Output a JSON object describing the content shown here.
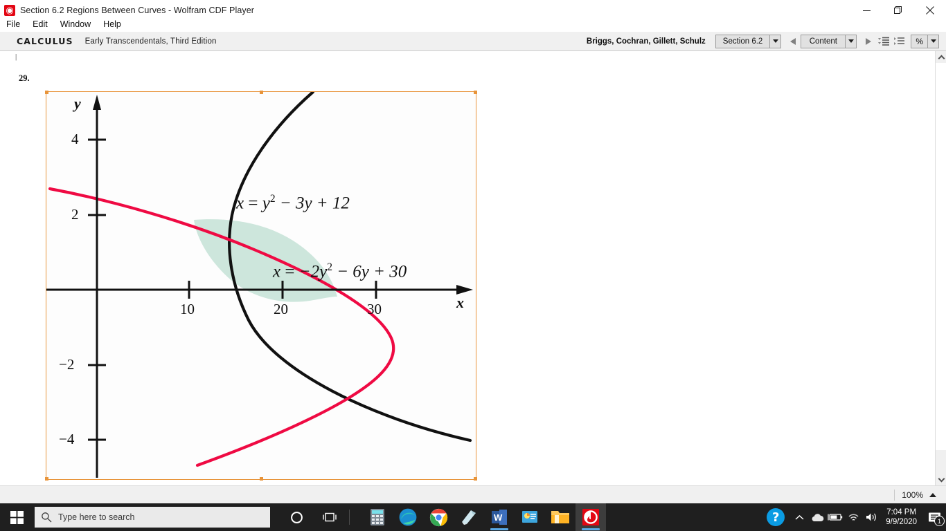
{
  "window": {
    "title": "Section 6.2 Regions Between Curves - Wolfram CDF Player",
    "app_icon": "wolfram-spikey-icon",
    "minimize_label": "Minimize",
    "maximize_label": "Restore",
    "close_label": "Close"
  },
  "menubar": {
    "items": [
      {
        "label": "File"
      },
      {
        "label": "Edit"
      },
      {
        "label": "Window"
      },
      {
        "label": "Help"
      }
    ]
  },
  "toolbar": {
    "brand": "CALCULUS",
    "subtitle": "Early Transcendentals, Third Edition",
    "authors": "Briggs, Cochran, Gillett, Schulz",
    "section_selector": "Section 6.2",
    "content_selector": "Content",
    "prev_label": "Previous",
    "next_label": "Next",
    "percent_selector": "%",
    "list_icon_1": "collapse-all-icon",
    "list_icon_2": "expand-all-icon"
  },
  "document": {
    "tick_above": "|",
    "problem_number": "29.",
    "figure": {
      "x_axis_name": "x",
      "y_axis_name": "y",
      "x_ticks": [
        "10",
        "20",
        "30"
      ],
      "y_ticks": [
        "4",
        "2",
        "−2",
        "−4"
      ],
      "equation_1": {
        "lhs": "x",
        "eq": "=",
        "term1": "y",
        "exp1": "2",
        "rest": "− 3y + 12",
        "color": "#111111"
      },
      "equation_2": {
        "lhs": "x",
        "eq": "=",
        "term1": "−2y",
        "exp1": "2",
        "rest": "− 6y + 30",
        "color": "#111111"
      },
      "colors": {
        "curve_black": "#111111",
        "curve_red": "#ef0a43",
        "region_fill": "#cde6dc",
        "selection_border": "#e8943a",
        "axis": "#111111"
      }
    }
  },
  "statusbar": {
    "zoom_level": "100%"
  },
  "taskbar": {
    "start_label": "Start",
    "search_placeholder": "Type here to search",
    "cortana_label": "Cortana",
    "task_view_label": "Task View",
    "pinned_apps": [
      {
        "name": "calculator-app",
        "label": "Calculator"
      },
      {
        "name": "edge-app",
        "label": "Microsoft Edge"
      },
      {
        "name": "chrome-app",
        "label": "Google Chrome"
      },
      {
        "name": "sticky-notes-app",
        "label": "Sticky Notes"
      },
      {
        "name": "word-app",
        "label": "Word"
      },
      {
        "name": "powerpoint-app",
        "label": "PowerPoint"
      },
      {
        "name": "file-explorer-app",
        "label": "File Explorer"
      },
      {
        "name": "wolfram-cdf-app",
        "label": "Wolfram CDF Player"
      }
    ],
    "tray": {
      "help_glyph": "?",
      "chevron_label": "Show hidden icons",
      "onedrive_label": "OneDrive",
      "battery_label": "Battery",
      "network_label": "Network",
      "volume_label": "Volume",
      "time": "7:04 PM",
      "date": "9/9/2020",
      "notifications_count": "1"
    }
  },
  "chart_data": {
    "type": "line",
    "title": "Region between two leftward/rightward parabolas",
    "xlabel": "x",
    "ylabel": "y",
    "xlim": [
      -4,
      44
    ],
    "ylim": [
      -5.4,
      5.4
    ],
    "grid": false,
    "legend": "none",
    "x_ticks": [
      10,
      20,
      30
    ],
    "y_ticks": [
      4,
      2,
      -2,
      -4
    ],
    "series": [
      {
        "name": "x = y^2 - 3y + 12",
        "color": "#111111",
        "equation": "x = y^2 - 3y + 12",
        "orientation": "x-of-y",
        "vertex": [
          9.75,
          1.5
        ],
        "points_y": [
          5.4,
          4,
          3,
          2,
          1.5,
          1,
          0,
          -1,
          -2,
          -3,
          -4
        ],
        "points_x": [
          25.0,
          16.0,
          12.0,
          10.0,
          9.75,
          10.0,
          12.0,
          16.0,
          22.0,
          30.0,
          40.0
        ]
      },
      {
        "name": "x = -2y^2 - 6y + 30",
        "color": "#ef0a43",
        "equation": "x = -2y^2 - 6y + 30",
        "orientation": "x-of-y",
        "vertex": [
          34.5,
          -1.5
        ],
        "points_y": [
          2.6,
          2,
          1,
          0,
          -1,
          -1.5,
          -2,
          -3,
          -4,
          -5
        ],
        "points_x": [
          0.9,
          10.0,
          22.0,
          30.0,
          34.0,
          34.5,
          34.0,
          30.0,
          22.0,
          10.0
        ]
      }
    ],
    "shaded_region": {
      "fill": "#cde6dc",
      "description": "Region bounded between x = y^2 - 3y + 12 and x = -2y^2 - 6y + 30",
      "intersections": [
        [
          10,
          2
        ],
        [
          30,
          -3
        ]
      ]
    }
  }
}
